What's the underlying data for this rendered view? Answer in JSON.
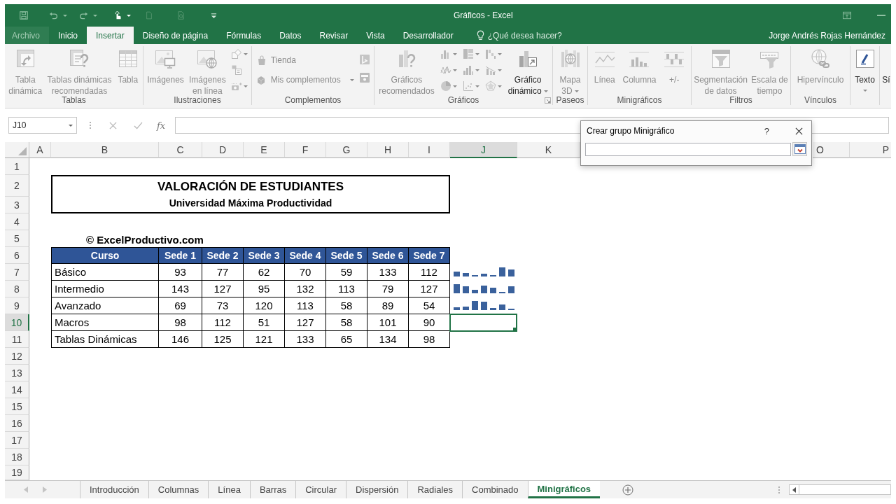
{
  "window": {
    "title": "Gráficos - Excel",
    "user": "Jorge Andrés Rojas Hernández"
  },
  "ribbon_tabs": [
    {
      "label": "Archivo",
      "selected": false,
      "disabled": true
    },
    {
      "label": "Inicio",
      "selected": false,
      "disabled": false
    },
    {
      "label": "Insertar",
      "selected": true,
      "disabled": false
    },
    {
      "label": "Diseño de página",
      "selected": false,
      "disabled": false
    },
    {
      "label": "Fórmulas",
      "selected": false,
      "disabled": false
    },
    {
      "label": "Datos",
      "selected": false,
      "disabled": false
    },
    {
      "label": "Revisar",
      "selected": false,
      "disabled": false
    },
    {
      "label": "Vista",
      "selected": false,
      "disabled": false
    },
    {
      "label": "Desarrollador",
      "selected": false,
      "disabled": false
    }
  ],
  "tell_me": {
    "placeholder": "¿Qué desea hacer?"
  },
  "ribbon_groups": [
    {
      "label": "Tablas",
      "launcher": false,
      "columns": [
        [
          {
            "kind": "large",
            "label": "Tabla\ndinámica",
            "disabled": true,
            "dropdown": false
          }
        ],
        [
          {
            "kind": "large",
            "label": "Tablas dinámicas\nrecomendadas",
            "disabled": true,
            "dropdown": false
          }
        ],
        [
          {
            "kind": "large",
            "label": "Tabla",
            "disabled": true,
            "dropdown": false
          }
        ]
      ]
    },
    {
      "label": "Ilustraciones",
      "launcher": false,
      "columns": [
        [
          {
            "kind": "large",
            "label": "Imágenes",
            "disabled": true,
            "dropdown": false
          }
        ],
        [
          {
            "kind": "large",
            "label": "Imágenes\nen línea",
            "disabled": true,
            "dropdown": false
          }
        ],
        [
          {
            "kind": "icon",
            "disabled": true,
            "dropdown": true
          },
          {
            "kind": "icon",
            "disabled": true,
            "dropdown": false
          },
          {
            "kind": "icon",
            "disabled": true,
            "dropdown": true
          }
        ]
      ]
    },
    {
      "label": "Complementos",
      "launcher": false,
      "columns": [
        [
          {
            "kind": "small",
            "label": "Tienda",
            "disabled": true,
            "dropdown": false
          },
          {
            "kind": "small",
            "label": "Mis complementos",
            "disabled": true,
            "dropdown": true
          }
        ],
        [
          {
            "kind": "icon",
            "disabled": true,
            "dropdown": false
          },
          {
            "kind": "icon",
            "disabled": true,
            "dropdown": false
          }
        ]
      ]
    },
    {
      "label": "Gráficos",
      "launcher": true,
      "columns": [
        [
          {
            "kind": "large",
            "label": "Gráficos\nrecomendados",
            "disabled": true,
            "dropdown": false
          }
        ],
        [
          {
            "kind": "icon",
            "disabled": true,
            "dropdown": true
          },
          {
            "kind": "icon",
            "disabled": true,
            "dropdown": true
          },
          {
            "kind": "icon",
            "disabled": true,
            "dropdown": true
          }
        ],
        [
          {
            "kind": "icon",
            "disabled": true,
            "dropdown": true
          },
          {
            "kind": "icon",
            "disabled": true,
            "dropdown": true
          },
          {
            "kind": "icon",
            "disabled": true,
            "dropdown": true
          }
        ],
        [
          {
            "kind": "icon",
            "disabled": true,
            "dropdown": true
          },
          {
            "kind": "icon",
            "disabled": true,
            "dropdown": true
          },
          {
            "kind": "icon",
            "disabled": true,
            "dropdown": true
          }
        ],
        [
          {
            "kind": "large",
            "label": "Gráfico\ndinámico",
            "disabled": false,
            "dropdown": true
          }
        ]
      ]
    },
    {
      "label": "Paseos",
      "launcher": false,
      "columns": [
        [
          {
            "kind": "large",
            "label": "Mapa\n3D",
            "disabled": true,
            "dropdown": true
          }
        ]
      ]
    },
    {
      "label": "Minigráficos",
      "launcher": false,
      "columns": [
        [
          {
            "kind": "large",
            "label": "Línea",
            "disabled": true,
            "dropdown": false
          }
        ],
        [
          {
            "kind": "large",
            "label": "Columna",
            "disabled": true,
            "dropdown": false
          }
        ],
        [
          {
            "kind": "large",
            "label": "+/-",
            "disabled": true,
            "dropdown": false
          }
        ]
      ]
    },
    {
      "label": "Filtros",
      "launcher": false,
      "columns": [
        [
          {
            "kind": "large",
            "label": "Segmentación\nde datos",
            "disabled": true,
            "dropdown": false
          }
        ],
        [
          {
            "kind": "large",
            "label": "Escala de\ntiempo",
            "disabled": true,
            "dropdown": false
          }
        ]
      ]
    },
    {
      "label": "Vínculos",
      "launcher": false,
      "columns": [
        [
          {
            "kind": "large",
            "label": "Hipervínculo",
            "disabled": true,
            "dropdown": false
          }
        ]
      ]
    },
    {
      "launcher": false,
      "columns": [
        [
          {
            "kind": "large",
            "label": "Texto",
            "disabled": false,
            "dropdown": true
          }
        ]
      ]
    },
    {
      "launcher": false,
      "columns": [
        [
          {
            "kind": "large",
            "label": "Sí",
            "disabled": false,
            "dropdown": false
          }
        ]
      ]
    }
  ],
  "formula_bar": {
    "name_box": "J10",
    "function_label": "fx"
  },
  "dialog": {
    "title": "Crear grupo Minigráfico",
    "help": "?"
  },
  "sheet": {
    "columns": [
      {
        "label": "A",
        "selected": false
      },
      {
        "label": "B",
        "selected": false
      },
      {
        "label": "C",
        "selected": false
      },
      {
        "label": "D",
        "selected": false
      },
      {
        "label": "E",
        "selected": false
      },
      {
        "label": "F",
        "selected": false
      },
      {
        "label": "G",
        "selected": false
      },
      {
        "label": "H",
        "selected": false
      },
      {
        "label": "I",
        "selected": false
      },
      {
        "label": "J",
        "selected": true
      },
      {
        "label": "K",
        "selected": false
      },
      {
        "label": "O",
        "selected": false
      },
      {
        "label": "P",
        "selected": false
      }
    ],
    "rows": [
      {
        "label": "1",
        "selected": false
      },
      {
        "label": "2",
        "selected": false
      },
      {
        "label": "3",
        "selected": false
      },
      {
        "label": "4",
        "selected": false
      },
      {
        "label": "5",
        "selected": false
      },
      {
        "label": "6",
        "selected": false
      },
      {
        "label": "7",
        "selected": false
      },
      {
        "label": "8",
        "selected": false
      },
      {
        "label": "9",
        "selected": false
      },
      {
        "label": "10",
        "selected": true
      },
      {
        "label": "11",
        "selected": false
      },
      {
        "label": "12",
        "selected": false
      },
      {
        "label": "13",
        "selected": false
      },
      {
        "label": "14",
        "selected": false
      },
      {
        "label": "15",
        "selected": false
      },
      {
        "label": "16",
        "selected": false
      },
      {
        "label": "17",
        "selected": false
      },
      {
        "label": "18",
        "selected": false
      },
      {
        "label": "19",
        "selected": false
      }
    ],
    "title": "VALORACIÓN DE ESTUDIANTES",
    "subtitle": "Universidad Máxima Productividad",
    "copyright": "© ExcelProductivo.com",
    "table": {
      "header": [
        "Curso",
        "Sede 1",
        "Sede 2",
        "Sede 3",
        "Sede 4",
        "Sede 5",
        "Sede 6",
        "Sede 7"
      ],
      "rows": [
        {
          "cells": [
            "Básico",
            "93",
            "77",
            "62",
            "70",
            "59",
            "133",
            "112"
          ],
          "sparkline": true
        },
        {
          "cells": [
            "Intermedio",
            "143",
            "127",
            "95",
            "132",
            "113",
            "79",
            "127"
          ],
          "sparkline": true
        },
        {
          "cells": [
            "Avanzado",
            "69",
            "73",
            "120",
            "113",
            "58",
            "89",
            "54"
          ],
          "sparkline": true
        },
        {
          "cells": [
            "Macros",
            "98",
            "112",
            "51",
            "127",
            "58",
            "101",
            "90"
          ],
          "sparkline": false
        },
        {
          "cells": [
            "Tablas Dinámicas",
            "146",
            "125",
            "121",
            "133",
            "65",
            "134",
            "98"
          ],
          "sparkline": false
        }
      ]
    }
  },
  "sheet_tabs": [
    {
      "label": "Introducción",
      "selected": false
    },
    {
      "label": "Columnas",
      "selected": false
    },
    {
      "label": "Línea",
      "selected": false
    },
    {
      "label": "Barras",
      "selected": false
    },
    {
      "label": "Circular",
      "selected": false
    },
    {
      "label": "Dispersión",
      "selected": false
    },
    {
      "label": "Radiales",
      "selected": false
    },
    {
      "label": "Combinado",
      "selected": false
    },
    {
      "label": "Minigráficos",
      "selected": true
    }
  ]
}
